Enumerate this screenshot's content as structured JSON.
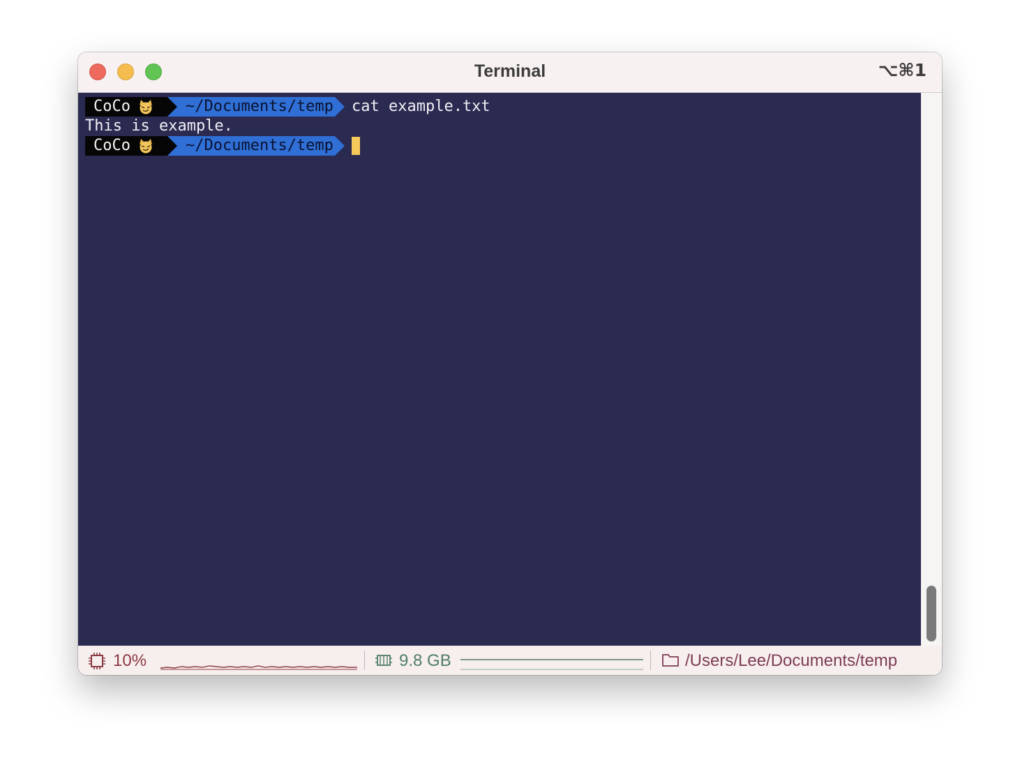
{
  "window": {
    "title": "Terminal",
    "shortcut": "⌥⌘1"
  },
  "terminal": {
    "lines": [
      {
        "type": "prompt",
        "user": "CoCo",
        "path": "~/Documents/temp",
        "command": "cat example.txt"
      },
      {
        "type": "output",
        "text": "This is example."
      },
      {
        "type": "prompt",
        "user": "CoCo",
        "path": "~/Documents/temp",
        "command": ""
      }
    ],
    "prompt_icon": "cat-face-icon",
    "colors": {
      "background": "#2b2a51",
      "user_segment": "#060607",
      "path_segment": "#2f6fd6",
      "cursor": "#f5c95a"
    }
  },
  "statusbar": {
    "cpu": {
      "icon": "cpu-icon",
      "value": "10%"
    },
    "memory": {
      "icon": "memory-icon",
      "value": "9.8 GB"
    },
    "path": {
      "icon": "folder-icon",
      "value": "/Users/Lee/Documents/temp"
    },
    "colors": {
      "cpu": "#8b3a42",
      "memory": "#4f7e68",
      "path": "#7d3d55"
    }
  }
}
